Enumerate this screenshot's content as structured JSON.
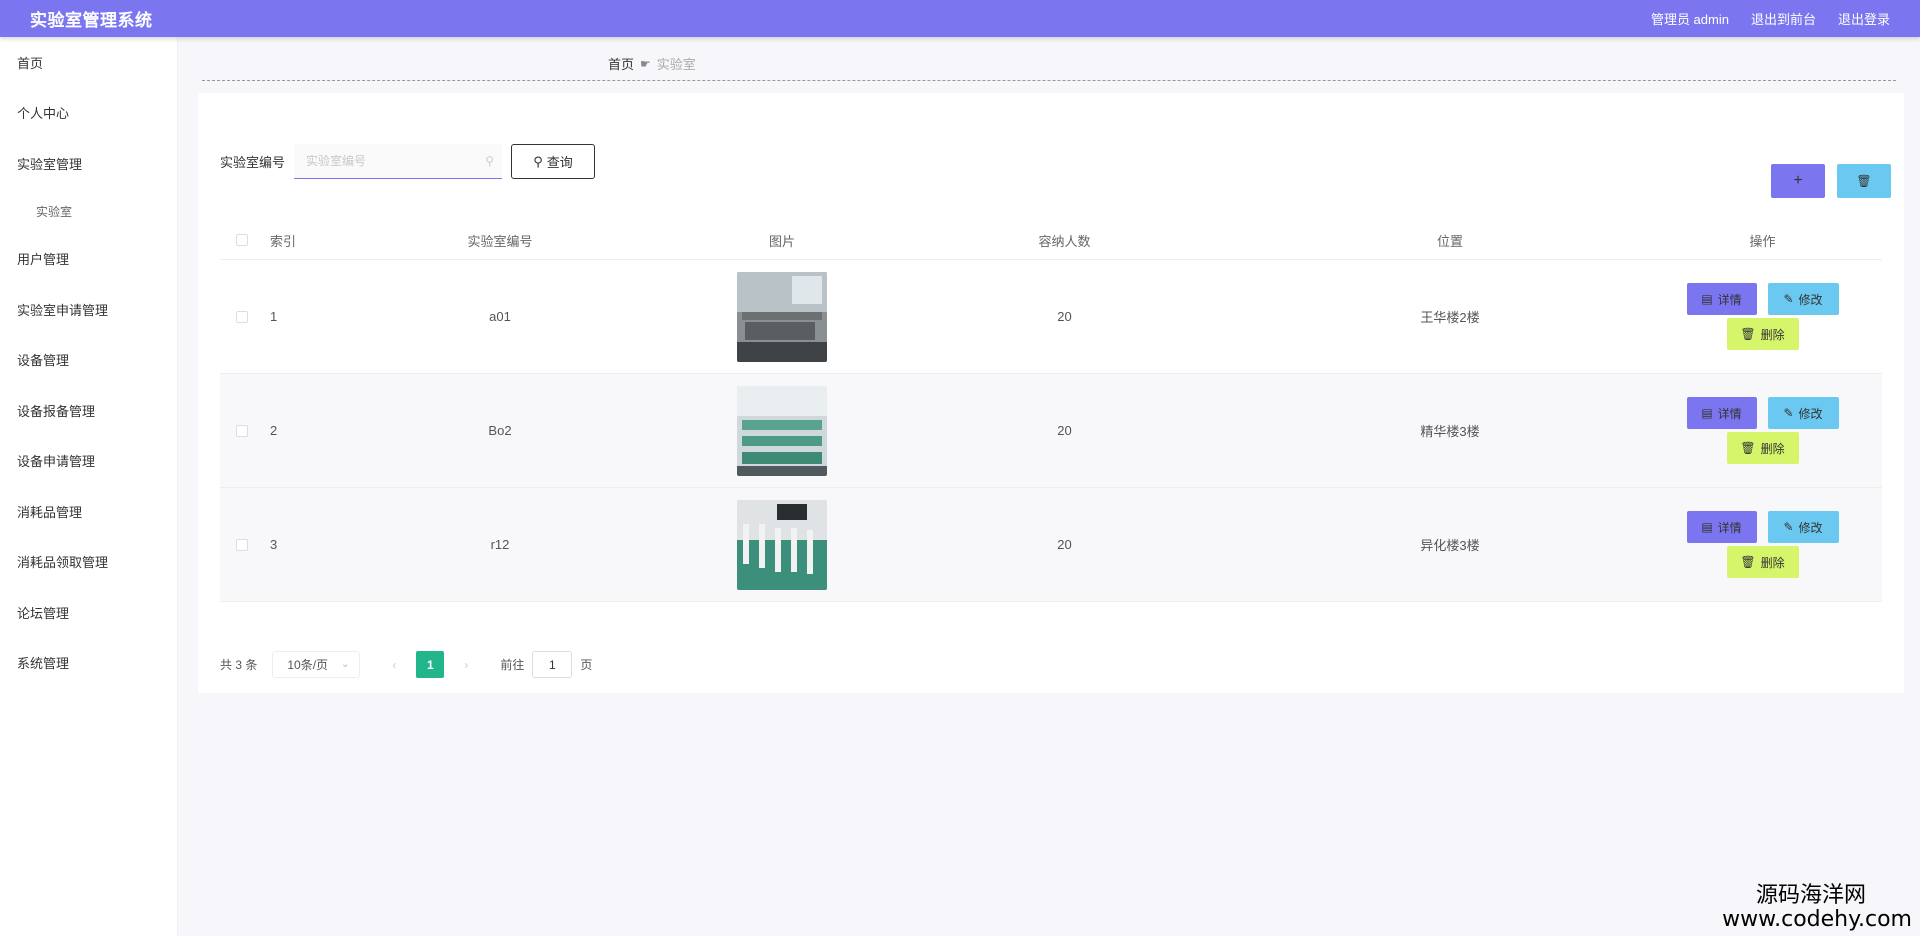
{
  "header": {
    "title": "实验室管理系统",
    "user": "管理员 admin",
    "to_front": "退出到前台",
    "logout": "退出登录"
  },
  "sidebar": {
    "items": [
      {
        "label": "首页"
      },
      {
        "label": "个人中心"
      },
      {
        "label": "实验室管理"
      },
      {
        "label": "实验室",
        "sub": true
      },
      {
        "label": "用户管理"
      },
      {
        "label": "实验室申请管理"
      },
      {
        "label": "设备管理"
      },
      {
        "label": "设备报备管理"
      },
      {
        "label": "设备申请管理"
      },
      {
        "label": "消耗品管理"
      },
      {
        "label": "消耗品领取管理"
      },
      {
        "label": "论坛管理"
      },
      {
        "label": "系统管理"
      }
    ]
  },
  "breadcrumb": {
    "home": "首页",
    "current": "实验室"
  },
  "search": {
    "label": "实验室编号",
    "placeholder": "实验室编号",
    "button": "查询"
  },
  "toolbar": {
    "add_label": "+"
  },
  "table": {
    "columns": {
      "index": "索引",
      "code": "实验室编号",
      "image": "图片",
      "capacity": "容纳人数",
      "location": "位置",
      "ops": "操作"
    },
    "rows": [
      {
        "index": "1",
        "code": "a01",
        "capacity": "20",
        "location": "王华楼2楼"
      },
      {
        "index": "2",
        "code": "Bo2",
        "capacity": "20",
        "location": "精华楼3楼"
      },
      {
        "index": "3",
        "code": "r12",
        "capacity": "20",
        "location": "异化楼3楼"
      }
    ],
    "ops": {
      "detail": "详情",
      "edit": "修改",
      "delete": "删除"
    }
  },
  "pagination": {
    "total": "共 3 条",
    "page_size": "10条/页",
    "current": "1",
    "goto_label": "前往",
    "goto_value": "1",
    "goto_suffix": "页"
  },
  "watermark": {
    "cn": "源码海洋网",
    "url": "www.codehy.com"
  },
  "colors": {
    "primary": "#7b76f0",
    "info": "#6bc8f0",
    "danger_btn": "#d6f56b",
    "page_active": "#22b58c"
  }
}
